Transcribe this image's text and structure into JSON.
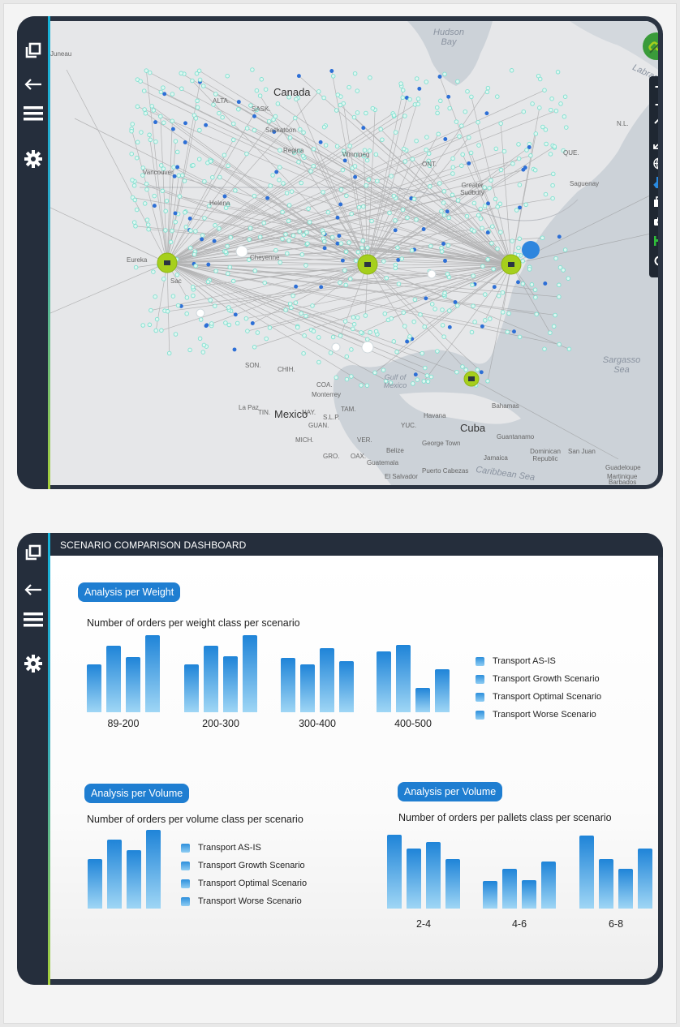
{
  "map": {
    "labels": {
      "hudson_bay": "Hudson Bay",
      "labrador": "Labrador",
      "juneau": "Juneau",
      "canada": "Canada",
      "alta": "ALTA.",
      "sask": "SASK.",
      "saskatoon": "Saskatoon",
      "regina": "Regina",
      "winnipeg": "Winnipeg",
      "ont": "ONT.",
      "greater_sudbury": "Greater Sudbury",
      "que": "QUE.",
      "saguenay": "Saguenay",
      "nl": "N.L.",
      "vancouver": "Vancouver",
      "helena": "Helena",
      "eureka": "Eureka",
      "cheyenne": "Cheyenne",
      "son": "SON.",
      "chih": "CHIH.",
      "coa": "COA.",
      "monterrey": "Monterrey",
      "mexico": "Mexico",
      "la_paz": "La Paz",
      "tam": "TAM.",
      "gulf_of_mexico": "Gulf of Mexico",
      "havana": "Havana",
      "cuba": "Cuba",
      "bahamas": "Bahamas",
      "guantanamo": "Guantanamo",
      "sargasso_sea": "Sargasso Sea",
      "george_town": "George Town",
      "jamaica": "Jamaica",
      "dominican_republic": "Dominican Republic",
      "san_juan": "San Juan",
      "caribbean_sea": "Caribbean Sea",
      "guadeloupe": "Guadeloupe",
      "martinique": "Martinique",
      "barbados": "Barbados",
      "belize": "Belize",
      "guatemala": "Guatemala",
      "el_salvador": "El Salvador",
      "puerto_cabezas": "Puerto Cabezas",
      "mich": "MICH.",
      "gro": "GRO.",
      "oax": "OAX.",
      "guan": "GUAN.",
      "yuc": "YUC.",
      "ver": "VER.",
      "nay": "NAY.",
      "slp": "S.L.P.",
      "tin": "TIN.",
      "sac": "Sac"
    },
    "toolbar": {
      "zoom_in": "+",
      "zoom_out": "−"
    },
    "colors": {
      "hub": "#a6cf1c",
      "hub_selected": "#2e86de",
      "customer": "#7fe0d0",
      "route": "#8a8a8a"
    }
  },
  "dashboard": {
    "title": "SCENARIO COMPARISON DASHBOARD",
    "weight_section": {
      "pill": "Analysis per Weight",
      "chart_title": "Number of orders per weight class per scenario"
    },
    "volume_section": {
      "pill": "Analysis per Volume",
      "chart_title": "Number of orders per volume class per scenario"
    },
    "pallets_section": {
      "pill": "Analysis per Volume",
      "chart_title": "Number of orders per pallets class per scenario"
    },
    "legend": [
      "Transport AS-IS",
      "Transport Growth Scenario",
      "Transport Optimal Scenario",
      "Transport Worse Scenario"
    ]
  },
  "chart_data": [
    {
      "type": "bar",
      "title": "Number of orders per weight class per scenario",
      "categories": [
        "89-200",
        "200-300",
        "300-400",
        "400-500"
      ],
      "series": [
        {
          "name": "Transport AS-IS",
          "values": [
            55,
            55,
            63,
            70
          ]
        },
        {
          "name": "Transport Growth Scenario",
          "values": [
            77,
            77,
            55,
            78
          ]
        },
        {
          "name": "Transport Optimal Scenario",
          "values": [
            64,
            65,
            74,
            28
          ]
        },
        {
          "name": "Transport Worse Scenario",
          "values": [
            89,
            89,
            59,
            50
          ]
        }
      ],
      "ylim": [
        0,
        90
      ]
    },
    {
      "type": "bar",
      "title": "Number of orders per volume class per scenario",
      "categories": [
        ""
      ],
      "series": [
        {
          "name": "Transport AS-IS",
          "values": [
            56
          ]
        },
        {
          "name": "Transport Growth Scenario",
          "values": [
            78
          ]
        },
        {
          "name": "Transport Optimal Scenario",
          "values": [
            66
          ]
        },
        {
          "name": "Transport Worse Scenario",
          "values": [
            89
          ]
        }
      ],
      "ylim": [
        0,
        90
      ]
    },
    {
      "type": "bar",
      "title": "Number of orders per pallets class per scenario",
      "categories": [
        "2-4",
        "4-6",
        "6-8"
      ],
      "series": [
        {
          "name": "Transport AS-IS",
          "values": [
            84,
            31,
            83
          ]
        },
        {
          "name": "Transport Growth Scenario",
          "values": [
            68,
            45,
            56
          ]
        },
        {
          "name": "Transport Optimal Scenario",
          "values": [
            75,
            32,
            45
          ]
        },
        {
          "name": "Transport Worse Scenario",
          "values": [
            56,
            53,
            68
          ]
        }
      ],
      "ylim": [
        0,
        90
      ]
    }
  ]
}
